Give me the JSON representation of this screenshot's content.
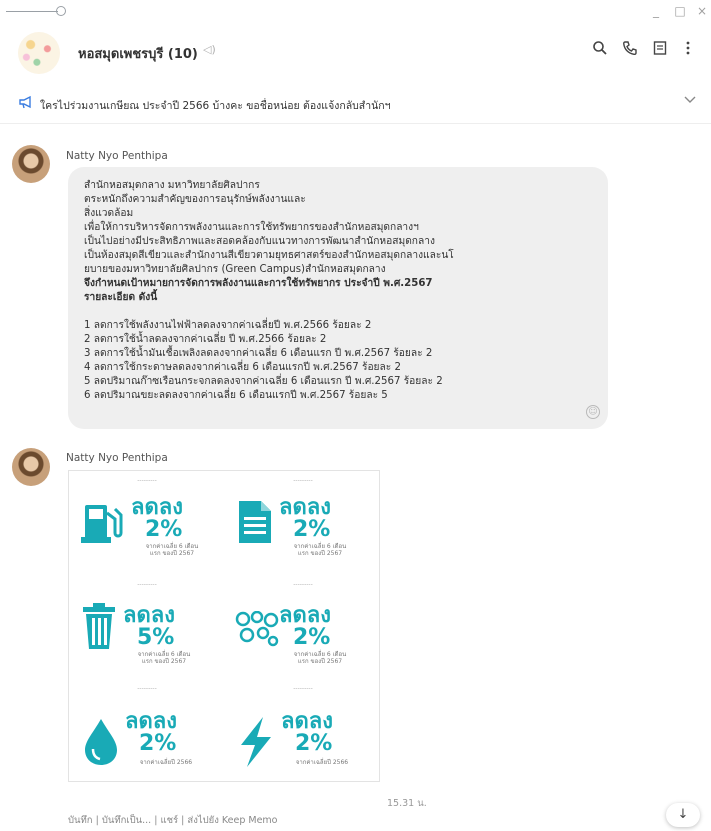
{
  "window": {
    "minimize": "_",
    "maximize": "□",
    "close": "×"
  },
  "header": {
    "title": "หอสมุดเพชรบุรี (10)",
    "mute_icon": "speaker-mute-icon",
    "search_icon": "search-icon",
    "call_icon": "phone-icon",
    "notes_icon": "notes-icon",
    "menu_icon": "more-vertical-icon"
  },
  "announcement": {
    "text": "ใครไปร่วมงานเกษียณ ประจำปี 2566 บ้างคะ ขอชื่อหน่อย ต้องแจ้งกลับสำนักฯ"
  },
  "messages": [
    {
      "sender": "Natty Nyo Penthipa",
      "lines": [
        "สำนักหอสมุดกลาง มหาวิทยาลัยศิลปากร",
        "ตระหนักถึงความสำคัญของการอนุรักษ์พลังงานและ",
        "สิ่งแวดล้อม",
        "เพื่อให้การบริหารจัดการพลังงานและการใช้ทรัพยากรของสำนักหอสมุดกลางฯ",
        "เป็นไปอย่างมีประสิทธิภาพและสอดคล้องกับแนวทางการพัฒนาสำนักหอสมุดกลาง",
        "เป็นห้องสมุดสีเขียวและสำนักงานสีเขียวตามยุทธศาสตร์ของสำนักหอสมุดกลางและนโ",
        "ยบายของมหาวิทยาลัยศิลปากร (Green Campus)สำนักหอสมุดกลาง",
        "จึงกำหนดเป้าหมายการจัดการพลังงานและการใช้ทรัพยากร ประจำปี พ.ศ.2567",
        "รายละเอียด ดังนี้"
      ],
      "items": [
        "1 ลดการใช้พลังงานไฟฟ้าลดลงจากค่าเฉลี่ยปี พ.ศ.2566 ร้อยละ 2",
        "2 ลดการใช้น้ำลดลงจากค่าเฉลี่ย ปี พ.ศ.2566 ร้อยละ 2",
        "3 ลดการใช้น้ำมันเชื้อเพลิงลดลงจากค่าเฉลี่ย 6 เดือนแรก ปี พ.ศ.2567 ร้อยละ 2",
        "4 ลดการใช้กระดาษลดลงจากค่าเฉลี่ย 6 เดือนแรกปี พ.ศ.2567 ร้อยละ 2",
        "5 ลดปริมาณก๊าซเรือนกระจกลดลงจากค่าเฉลี่ย 6 เดือนแรก ปี พ.ศ.2567 ร้อยละ 2",
        "6 ลดปริมาณขยะลดลงจากค่าเฉลี่ย 6 เดือนแรกปี พ.ศ.2567 ร้อยละ 5"
      ]
    },
    {
      "sender": "Natty Nyo Penthipa",
      "image": {
        "cells": [
          {
            "icon": "fuel-pump-icon",
            "label": "ลดลง",
            "percent": "2%",
            "caption": "จากค่าเฉลี่ย 6 เดือนแรก ของปี 2567"
          },
          {
            "icon": "document-icon",
            "label": "ลดลง",
            "percent": "2%",
            "caption": "จากค่าเฉลี่ย 6 เดือนแรก ของปี 2567"
          },
          {
            "icon": "trash-bin-icon",
            "label": "ลดลง",
            "percent": "5%",
            "caption": "จากค่าเฉลี่ย 6 เดือนแรก ของปี 2567"
          },
          {
            "icon": "gas-cloud-icon",
            "label": "ลดลง",
            "percent": "2%",
            "caption": "จากค่าเฉลี่ย 6 เดือนแรก ของปี 2567"
          },
          {
            "icon": "water-drop-icon",
            "label": "ลดลง",
            "percent": "2%",
            "caption": "จากค่าเฉลี่ยปี 2566"
          },
          {
            "icon": "lightning-icon",
            "label": "ลดลง",
            "percent": "2%",
            "caption": "จากค่าเฉลี่ยปี 2566"
          }
        ]
      },
      "time": "15.31 น."
    }
  ],
  "actions": {
    "a1": "บันทึก",
    "a2": "บันทึกเป็น...",
    "a3": "แชร์",
    "a4": "ส่งไปยัง Keep Memo",
    "sep": "|"
  },
  "colors": {
    "accent": "#19aab6",
    "announce_icon": "#3b7de0",
    "bubble": "#efefef"
  }
}
